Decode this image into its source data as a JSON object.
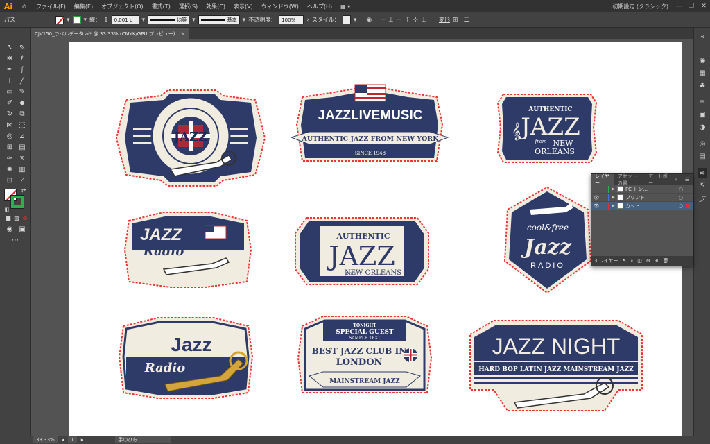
{
  "app": {
    "logo": "Ai",
    "workspace": "初期設定 (クラシック)"
  },
  "menu": [
    "ファイル(F)",
    "編集(E)",
    "オブジェクト(O)",
    "書式(T)",
    "選択(S)",
    "効果(C)",
    "表示(V)",
    "ウィンドウ(W)",
    "ヘルプ(H)"
  ],
  "control": {
    "selection_label": "パス",
    "stroke_label": "線：",
    "stroke_value": "0.001 p",
    "profile_label": "均等",
    "brush_label": "基本",
    "opacity_label": "不透明度：",
    "opacity_value": "100%",
    "style_label": "スタイル：",
    "transform_label": "変形"
  },
  "document_tab": {
    "title": "CJV150_ラベルデータ.ai* @ 33.33% (CMYK/GPU プレビュー)",
    "close": "×"
  },
  "status": {
    "zoom": "33.33%",
    "artboard": "1",
    "tool": "手のひら"
  },
  "layers_panel": {
    "tabs": [
      "レイヤー",
      "アセットの書",
      "アートボー"
    ],
    "layers": [
      {
        "name": "FC トン…",
        "color": "#2ab24a",
        "visible": false,
        "selected": false
      },
      {
        "name": "プリント",
        "color": "#4a6fe0",
        "visible": true,
        "selected": false
      },
      {
        "name": "カット…",
        "color": "#e03030",
        "visible": true,
        "selected": true
      }
    ],
    "footer": "3 レイヤー"
  },
  "labels": {
    "l1": {
      "line1": "JAZZ",
      "ring": "Blue Band Chamber Jazz Continental Jazz cool Jazz Bebop"
    },
    "l2": {
      "title": "JAZZLIVEMUSIC",
      "banner": "AUTHENTIC JAZZ FROM NEW YORK",
      "since": "SINCE 1948"
    },
    "l3": {
      "top": "AUTHENTIC",
      "main": "JAZZ",
      "from": "from",
      "bottom1": "NEW",
      "bottom2": "ORLEANS"
    },
    "l4": {
      "main": "JAZZ",
      "script": "Radio"
    },
    "l5": {
      "top": "AUTHENTIC",
      "main": "JAZZ",
      "from": "from",
      "bottom": "NEW ORLEANS"
    },
    "l6": {
      "top": "cool&free",
      "main": "Jazz",
      "bottom": "RADIO"
    },
    "l7": {
      "main": "Jazz",
      "script": "Radio"
    },
    "l8": {
      "tonight": "TONIGHT",
      "guest": "SPECIAL GUEST",
      "sample": "SAMPLE TEXT",
      "club1": "BEST JAZZ CLUB IN",
      "club2": "LONDON",
      "banner": "MAINSTREAM JAZZ"
    },
    "l9": {
      "main": "JAZZ NIGHT",
      "sub": "HARD BOP LATIN JAZZ MAINSTREAM JAZZ"
    }
  }
}
